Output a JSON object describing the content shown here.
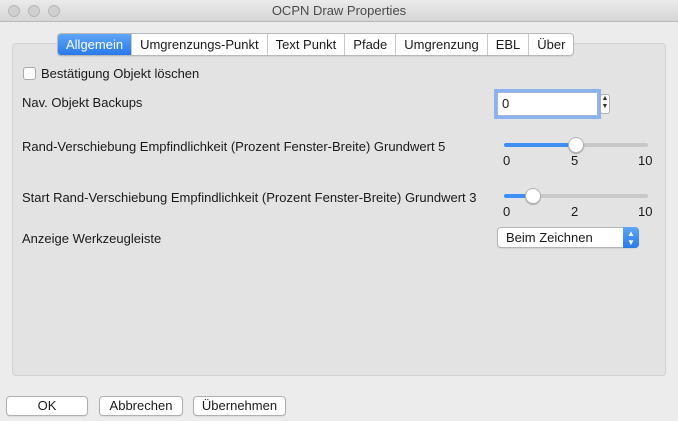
{
  "window": {
    "title": "OCPN Draw Properties"
  },
  "tabs": [
    {
      "label": "Allgemein",
      "active": true
    },
    {
      "label": "Umgrenzungs-Punkt",
      "active": false
    },
    {
      "label": "Text Punkt",
      "active": false
    },
    {
      "label": "Pfade",
      "active": false
    },
    {
      "label": "Umgrenzung",
      "active": false
    },
    {
      "label": "EBL",
      "active": false
    },
    {
      "label": "Über",
      "active": false
    }
  ],
  "general": {
    "confirm_delete": {
      "label": "Bestätigung Objekt löschen",
      "checked": false
    },
    "backups": {
      "label": "Nav. Objekt Backups",
      "value": "0"
    },
    "edge_pan": {
      "label": "Rand-Verschiebung Empfindlichkeit (Prozent Fenster-Breite) Grundwert 5",
      "min": "0",
      "value": "5",
      "max": "10",
      "level": 5
    },
    "initial_edge_pan": {
      "label": "Start Rand-Verschiebung Empfindlichkeit (Prozent Fenster-Breite) Grundwert 3",
      "min": "0",
      "value": "2",
      "max": "10",
      "level": 2
    },
    "toolbar": {
      "label": "Anzeige Werkzeugleiste",
      "selected": "Beim Zeichnen"
    }
  },
  "buttons": {
    "ok": "OK",
    "cancel": "Abbrechen",
    "apply": "Übernehmen"
  },
  "colors": {
    "accent": "#3d8ef5",
    "focus_ring": "#8bb4ef",
    "panel": "#e3e3e3",
    "window": "#ececec"
  }
}
